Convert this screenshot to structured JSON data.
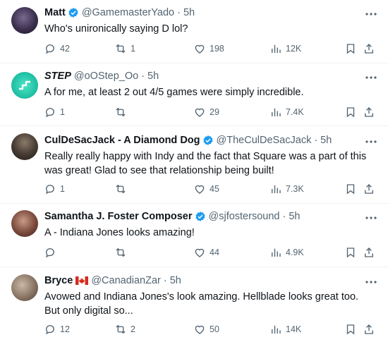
{
  "tweets": [
    {
      "name": "Matt",
      "verified": true,
      "handle": "@GamemasterYado",
      "time": "5h",
      "text": "Who's unironically saying D lol?",
      "replies": "42",
      "retweets": "1",
      "likes": "198",
      "views": "12K"
    },
    {
      "name": "STEP",
      "verified": false,
      "handle": "@oOStep_Oo",
      "time": "5h",
      "text": "A for me, at least 2 out 4/5 games were simply incredible.",
      "replies": "1",
      "retweets": "",
      "likes": "29",
      "views": "7.4K"
    },
    {
      "name": "CulDeSacJack - A Diamond Dog",
      "verified": true,
      "handle": "@TheCulDeSacJack",
      "time": "5h",
      "text": "Really really happy with Indy and the fact that Square was a part of this was great! Glad to see that relationship being built!",
      "replies": "1",
      "retweets": "",
      "likes": "45",
      "views": "7.3K"
    },
    {
      "name": "Samantha J. Foster Composer",
      "verified": true,
      "handle": "@sjfostersound",
      "time": "5h",
      "text": "A - Indiana Jones looks amazing!",
      "replies": "",
      "retweets": "",
      "likes": "44",
      "views": "4.9K"
    },
    {
      "name": "Bryce",
      "verified": false,
      "flag": "canada-flag",
      "handle": "@CanadianZar",
      "time": "5h",
      "text": "Avowed and Indiana Jones's look amazing. Hellblade looks great too. But only digital so...",
      "replies": "12",
      "retweets": "2",
      "likes": "50",
      "views": "14K"
    }
  ],
  "separator": "·",
  "colors": {
    "text": "#0f1419",
    "secondary": "#536471",
    "verified": "#1d9bf0",
    "divider": "#eff3f4"
  }
}
